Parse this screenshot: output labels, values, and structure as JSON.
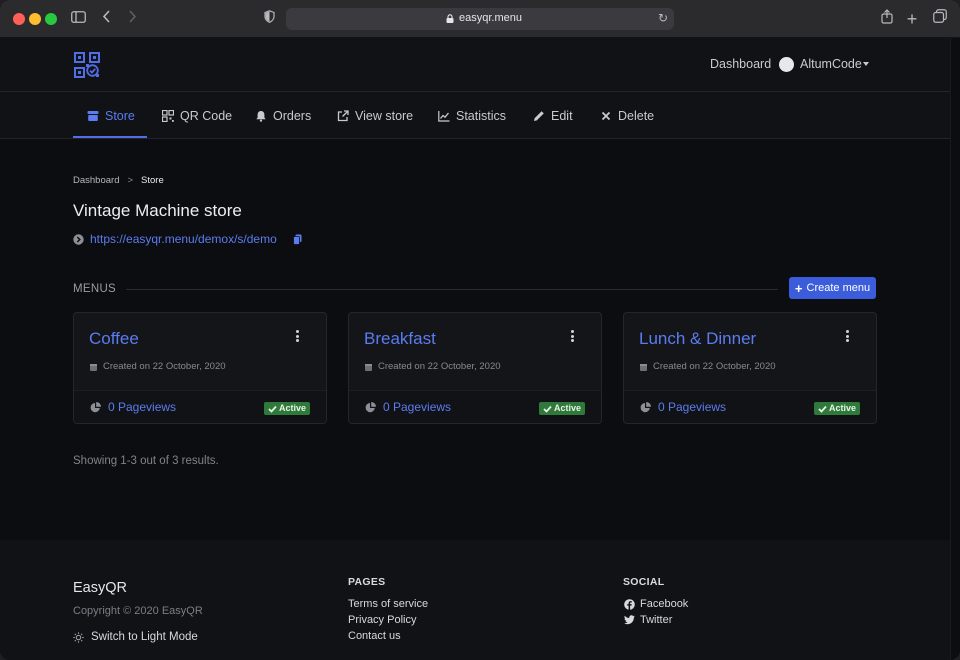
{
  "browser": {
    "url": "easyqr.menu"
  },
  "header": {
    "dashboard_label": "Dashboard",
    "user_name": "AltumCode"
  },
  "nav": {
    "items": [
      {
        "label": "Store"
      },
      {
        "label": "QR Code"
      },
      {
        "label": "Orders"
      },
      {
        "label": "View store"
      },
      {
        "label": "Statistics"
      },
      {
        "label": "Edit"
      },
      {
        "label": "Delete"
      }
    ],
    "active_index": 0
  },
  "breadcrumb": {
    "root": "Dashboard",
    "separator": ">",
    "current": "Store"
  },
  "page": {
    "title": "Vintage Machine store",
    "store_url": "https://easyqr.menu/demox/s/demo"
  },
  "menus": {
    "section_label": "MENUS",
    "create_label": "Create menu",
    "cards": [
      {
        "title": "Coffee",
        "created": "Created on 22 October, 2020",
        "pageviews": "0 Pageviews",
        "status": "Active"
      },
      {
        "title": "Breakfast",
        "created": "Created on 22 October, 2020",
        "pageviews": "0 Pageviews",
        "status": "Active"
      },
      {
        "title": "Lunch & Dinner",
        "created": "Created on 22 October, 2020",
        "pageviews": "0 Pageviews",
        "status": "Active"
      }
    ],
    "results_text": "Showing 1-3 out of 3 results."
  },
  "footer": {
    "brand": "EasyQR",
    "copyright": "Copyright © 2020 EasyQR",
    "mode_toggle": "Switch to Light Mode",
    "pages_heading": "PAGES",
    "pages_links": [
      "Terms of service",
      "Privacy Policy",
      "Contact us"
    ],
    "social_heading": "SOCIAL",
    "social_links": [
      "Facebook",
      "Twitter"
    ]
  },
  "colors": {
    "accent": "#5b7cf0",
    "button": "#3b5ddc",
    "badge_active": "#2f7a3a",
    "background": "#0c0d10",
    "surface": "#111216"
  }
}
